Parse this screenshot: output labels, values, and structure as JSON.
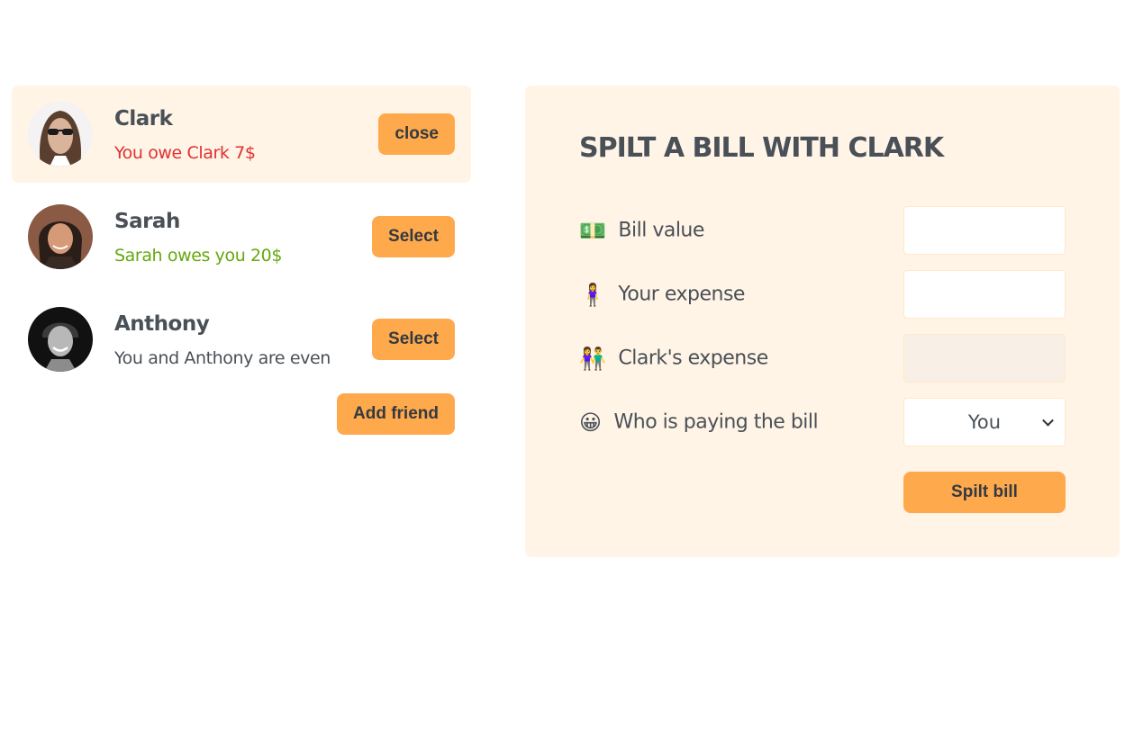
{
  "friends": [
    {
      "name": "Clark",
      "status": "You owe Clark 7$",
      "status_type": "owe",
      "button": "close",
      "selected": true,
      "avatar": "clark-photo"
    },
    {
      "name": "Sarah",
      "status": "Sarah owes you 20$",
      "status_type": "owed",
      "button": "Select",
      "selected": false,
      "avatar": "sarah-photo"
    },
    {
      "name": "Anthony",
      "status": "You and Anthony are even",
      "status_type": "even",
      "button": "Select",
      "selected": false,
      "avatar": "anthony-photo"
    }
  ],
  "sidebar": {
    "add_friend_label": "Add friend"
  },
  "form": {
    "title": "SPILT A BILL WITH CLARK",
    "fields": {
      "bill_value": {
        "icon": "💵",
        "icon_name": "dollar-banknote",
        "label": "Bill value",
        "value": ""
      },
      "your_expense": {
        "icon": "🧍‍♀️",
        "icon_name": "woman-standing",
        "label": "Your expense",
        "value": ""
      },
      "friend_expense": {
        "icon": "👫",
        "icon_name": "couple-holding-hands",
        "label": "Clark's expense",
        "value": ""
      },
      "payer": {
        "icon": "😀",
        "icon_name": "grinning-face",
        "label": "Who is paying the bill",
        "selected": "You"
      }
    },
    "submit_label": "Spilt bill"
  },
  "colors": {
    "accent": "#ffa94d",
    "panel_bg": "#fff4e6",
    "owe": "#e03131",
    "owed": "#66a80f",
    "text": "#495057"
  }
}
